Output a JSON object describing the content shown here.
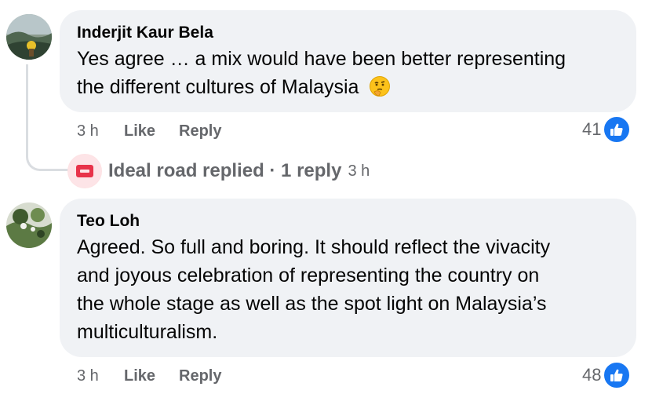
{
  "comments": [
    {
      "author": "Inderjit Kaur Bela",
      "text_lines": [
        "Yes agree … a mix would have been better representing",
        "the different cultures of Malaysia"
      ],
      "emoji": "thinking-face",
      "time": "3 h",
      "like_label": "Like",
      "reply_label": "Reply",
      "reaction_count": "41",
      "reaction_icon": "thumbs-up-icon"
    },
    {
      "author": "Teo Loh",
      "text_lines": [
        "Agreed. So full and boring. It should reflect the vivacity",
        "and joyous celebration of representing the country on",
        "the whole stage as well as the spot light on Malaysia’s",
        "multiculturalism."
      ],
      "time": "3 h",
      "like_label": "Like",
      "reply_label": "Reply",
      "reaction_count": "48",
      "reaction_icon": "thumbs-up-icon"
    }
  ],
  "reply_summary": {
    "text": "Ideal road replied · 1 reply",
    "time": "3 h"
  },
  "colors": {
    "bubble_bg": "#f0f2f5",
    "meta_text": "#65676b",
    "like_blue": "#1877f2",
    "thread_line": "#dadde1"
  }
}
